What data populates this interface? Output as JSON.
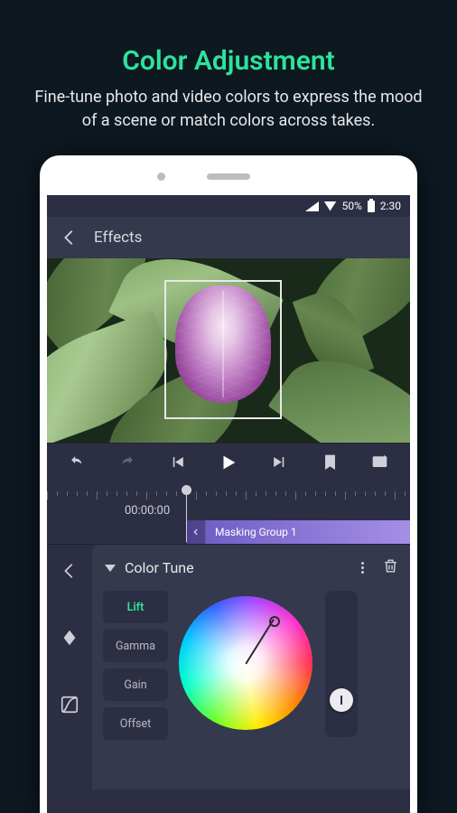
{
  "promo": {
    "title": "Color Adjustment",
    "subtitle": "Fine-tune photo and video colors to express the mood of a scene or match colors across takes."
  },
  "statusbar": {
    "battery": "50%",
    "time": "2:30"
  },
  "topbar": {
    "title": "Effects"
  },
  "timeline": {
    "timecode": "00:00:00",
    "clip_label": "Masking Group 1"
  },
  "panel": {
    "title": "Color Tune",
    "tabs": [
      {
        "label": "Lift",
        "active": true
      },
      {
        "label": "Gamma",
        "active": false
      },
      {
        "label": "Gain",
        "active": false
      },
      {
        "label": "Offset",
        "active": false
      }
    ]
  },
  "icons": {
    "back": "back-arrow",
    "undo": "undo-icon",
    "redo": "redo-icon",
    "prev": "skip-prev-icon",
    "play": "play-icon",
    "next": "skip-next-icon",
    "bookmark": "bookmark-add-icon",
    "fullscreen": "present-icon",
    "side_back": "panel-back-icon",
    "side_key": "keyframe-icon",
    "side_curve": "curve-icon",
    "more": "more-icon",
    "trash": "trash-icon"
  }
}
